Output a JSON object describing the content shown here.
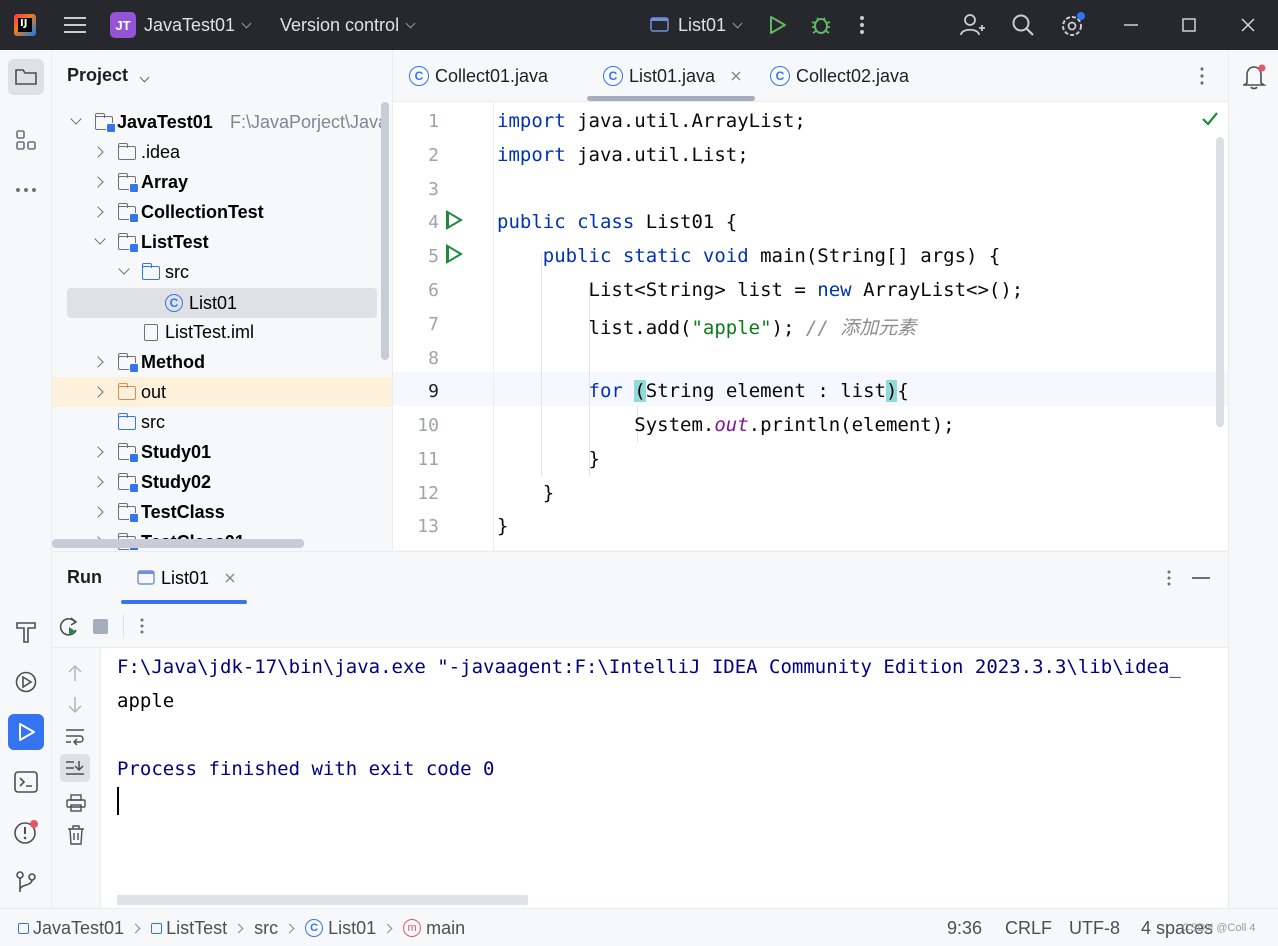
{
  "titlebar": {
    "app_logo": "intellij-logo",
    "project_badge": "JT",
    "project_name": "JavaTest01",
    "version_control": "Version control",
    "run_config": "List01"
  },
  "project_panel": {
    "title": "Project",
    "tree": [
      {
        "label": "JavaTest01",
        "path": "F:\\JavaPorject\\Java",
        "bold": true
      },
      {
        "label": ".idea"
      },
      {
        "label": "Array",
        "bold": true
      },
      {
        "label": "CollectionTest",
        "bold": true
      },
      {
        "label": "ListTest",
        "bold": true
      },
      {
        "label": "src"
      },
      {
        "label": "List01"
      },
      {
        "label": "ListTest.iml"
      },
      {
        "label": "Method",
        "bold": true
      },
      {
        "label": "out"
      },
      {
        "label": "src"
      },
      {
        "label": "Study01",
        "bold": true
      },
      {
        "label": "Study02",
        "bold": true
      },
      {
        "label": "TestClass",
        "bold": true
      },
      {
        "label": "TestClass01",
        "bold": true
      }
    ]
  },
  "editor": {
    "tabs": [
      {
        "label": "Collect01.java",
        "active": false
      },
      {
        "label": "List01.java",
        "active": true
      },
      {
        "label": "Collect02.java",
        "active": false
      }
    ],
    "line_numbers": [
      "1",
      "2",
      "3",
      "4",
      "5",
      "6",
      "7",
      "8",
      "9",
      "10",
      "11",
      "12",
      "13"
    ],
    "code": {
      "l1_kw": "import",
      "l1_rest": " java.util.ArrayList;",
      "l2_kw": "import",
      "l2_rest": " java.util.List;",
      "l4_kw": "public class",
      "l4_rest": " List01 {",
      "l5_indent": "    ",
      "l5_kw": "public static void",
      "l5_mid": " main(String[] args) {",
      "l6_a": "        List<String> list = ",
      "l6_kw": "new",
      "l6_b": " ArrayList<>();",
      "l7_a": "        list.add(",
      "l7_str": "\"apple\"",
      "l7_b": "); ",
      "l7_cmt": "// 添加元素",
      "l9_indent": "        ",
      "l9_kw": "for",
      "l9_sp": " ",
      "l9_open": "(",
      "l9_mid": "String element : list",
      "l9_close": ")",
      "l9_end": "{",
      "l10_a": "            System.",
      "l10_fld": "out",
      "l10_b": ".println(element);",
      "l11": "        }",
      "l12": "    }",
      "l13": "}"
    }
  },
  "run_panel": {
    "title": "Run",
    "tab_label": "List01",
    "console": [
      "F:\\Java\\jdk-17\\bin\\java.exe \"-javaagent:F:\\IntelliJ IDEA Community Edition 2023.3.3\\lib\\idea_",
      "apple",
      "",
      "Process finished with exit code 0"
    ]
  },
  "statusbar": {
    "breadcrumb": [
      "JavaTest01",
      "ListTest",
      "src",
      "List01",
      "main"
    ],
    "position": "9:36",
    "line_sep": "CRLF",
    "encoding": "UTF-8",
    "indent": "4 spaces",
    "watermark": "CSDN @Coll 4"
  },
  "colors": {
    "titlebar_bg": "#27282e",
    "accent": "#3574f0",
    "keyword": "#0033b3",
    "string": "#067d17",
    "run_green": "#208a3c"
  }
}
